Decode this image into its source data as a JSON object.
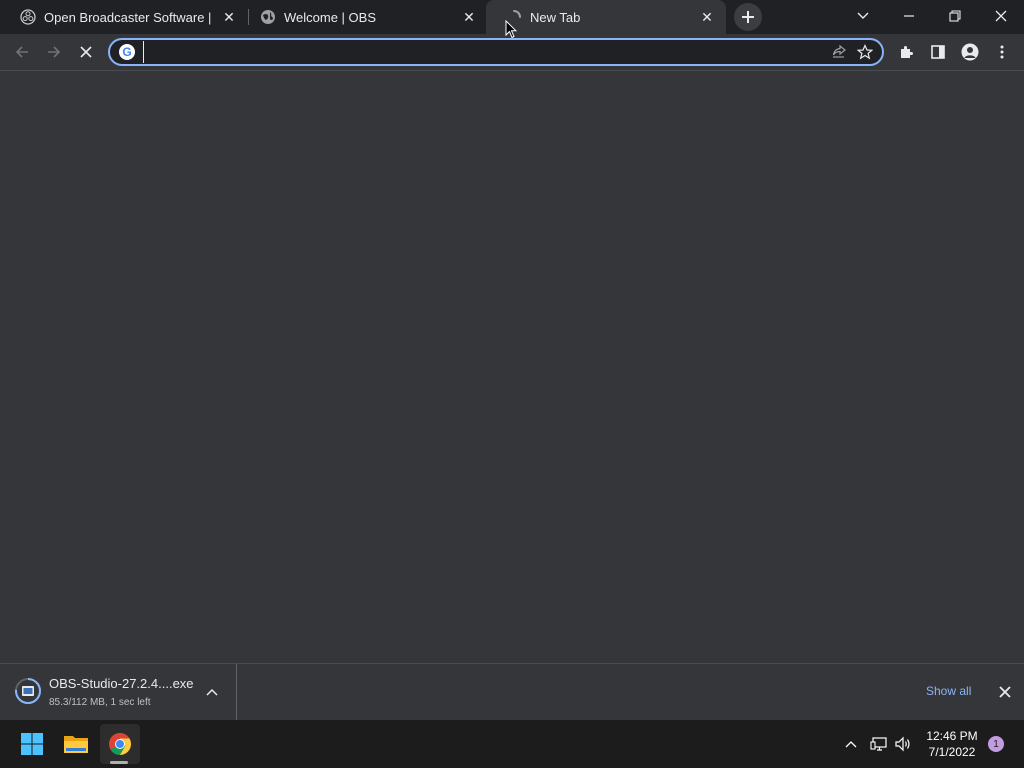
{
  "tabs": [
    {
      "title": "Open Broadcaster Software | OBS",
      "favicon": "obs-icon"
    },
    {
      "title": "Welcome | OBS",
      "favicon": "globe-icon"
    },
    {
      "title": "New Tab",
      "favicon": "loading-spinner-icon",
      "active": true
    }
  ],
  "omnibox": {
    "value": "",
    "search_engine_icon": "G"
  },
  "download": {
    "filename": "OBS-Studio-27.2.4....exe",
    "status": "85.3/112 MB, 1 sec left"
  },
  "shelf": {
    "show_all_label": "Show all"
  },
  "taskbar": {
    "time": "12:46 PM",
    "date": "7/1/2022",
    "notification_count": "1"
  },
  "colors": {
    "tabstrip_bg": "#202124",
    "toolbar_bg": "#35363a",
    "accent": "#8ab4f8",
    "taskbar_bg": "#1c1c1c"
  }
}
